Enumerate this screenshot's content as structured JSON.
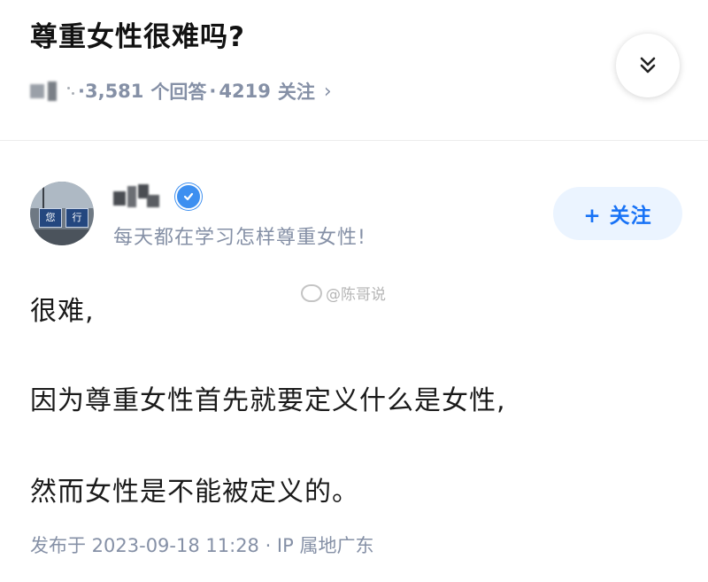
{
  "question": {
    "title": "尊重女性很难吗?",
    "meta_prefix": "3,581",
    "answers_label": "个回答",
    "separator": "·",
    "followers": "4219",
    "followers_label": "关注",
    "chevron": "›"
  },
  "collapse_button": {
    "icon": "double-chevron-down-icon"
  },
  "answer": {
    "author": {
      "avatar_sign_1": "您",
      "avatar_sign_2": "行",
      "bio": "每天都在学习怎样尊重女性!"
    },
    "follow_label": "+ 关注",
    "watermark": "@陈哥说",
    "paragraphs": [
      "很难,",
      "因为尊重女性首先就要定义什么是女性,",
      "然而女性是不能被定义的。"
    ],
    "timestamp": "发布于 2023-09-18 11:28 · IP 属地广东"
  },
  "colors": {
    "accent": "#1772f6",
    "follow_bg": "#ebf4ff",
    "meta_gray": "#8590a6",
    "verify_blue": "#3d8ff0"
  }
}
